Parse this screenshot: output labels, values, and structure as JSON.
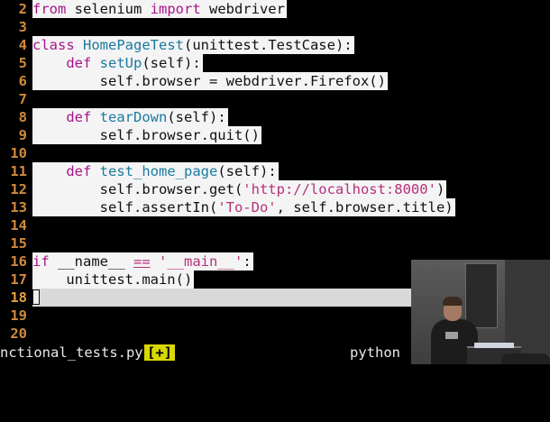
{
  "editor": {
    "lines": [
      {
        "num": "2",
        "segments": [
          {
            "text": "from",
            "cls": "kw"
          },
          {
            "text": " selenium "
          },
          {
            "text": "import",
            "cls": "kw"
          },
          {
            "text": " webdriver"
          }
        ]
      },
      {
        "num": "3",
        "segments": []
      },
      {
        "num": "4",
        "segments": [
          {
            "text": "class",
            "cls": "kw"
          },
          {
            "text": " "
          },
          {
            "text": "HomePageTest",
            "cls": "fn"
          },
          {
            "text": "(unittest.TestCase):"
          }
        ]
      },
      {
        "num": "5",
        "segments": [
          {
            "text": "    "
          },
          {
            "text": "def",
            "cls": "kw"
          },
          {
            "text": " "
          },
          {
            "text": "setUp",
            "cls": "fn"
          },
          {
            "text": "(self):"
          }
        ]
      },
      {
        "num": "6",
        "segments": [
          {
            "text": "        self.browser = webdriver.Firefox()"
          }
        ]
      },
      {
        "num": "7",
        "segments": []
      },
      {
        "num": "8",
        "segments": [
          {
            "text": "    "
          },
          {
            "text": "def",
            "cls": "kw"
          },
          {
            "text": " "
          },
          {
            "text": "tearDown",
            "cls": "fn"
          },
          {
            "text": "(self):"
          }
        ]
      },
      {
        "num": "9",
        "segments": [
          {
            "text": "        self.browser.quit()"
          }
        ]
      },
      {
        "num": "10",
        "segments": []
      },
      {
        "num": "11",
        "segments": [
          {
            "text": "    "
          },
          {
            "text": "def",
            "cls": "kw"
          },
          {
            "text": " "
          },
          {
            "text": "test_home_page",
            "cls": "fn"
          },
          {
            "text": "(self):"
          }
        ]
      },
      {
        "num": "12",
        "segments": [
          {
            "text": "        self.browser.get("
          },
          {
            "text": "'http://localhost:8000'",
            "cls": "str"
          },
          {
            "text": ")"
          }
        ]
      },
      {
        "num": "13",
        "segments": [
          {
            "text": "        self.assertIn("
          },
          {
            "text": "'To-Do'",
            "cls": "str"
          },
          {
            "text": ", self.browser.title)"
          }
        ]
      },
      {
        "num": "14",
        "segments": []
      },
      {
        "num": "15",
        "segments": []
      },
      {
        "num": "16",
        "segments": [
          {
            "text": "if",
            "cls": "kw"
          },
          {
            "text": " __name__ "
          },
          {
            "text": "==",
            "cls": "ops"
          },
          {
            "text": " "
          },
          {
            "text": "'__main__'",
            "cls": "str"
          },
          {
            "text": ":"
          }
        ]
      },
      {
        "num": "17",
        "segments": [
          {
            "text": "    unittest.main()"
          }
        ]
      },
      {
        "num": "18",
        "segments": [],
        "cursor": true
      },
      {
        "num": "19",
        "segments": []
      },
      {
        "num": "20",
        "segments": []
      }
    ]
  },
  "statusbar": {
    "filename": "nctional_tests.py",
    "modified": "[+]",
    "filetype": "python"
  },
  "colors": {
    "keyword": "#a8148a",
    "function": "#1a7aa0",
    "string": "#b5307a",
    "line_number": "#d08a3a",
    "modified_flag_bg": "#d8d800"
  }
}
